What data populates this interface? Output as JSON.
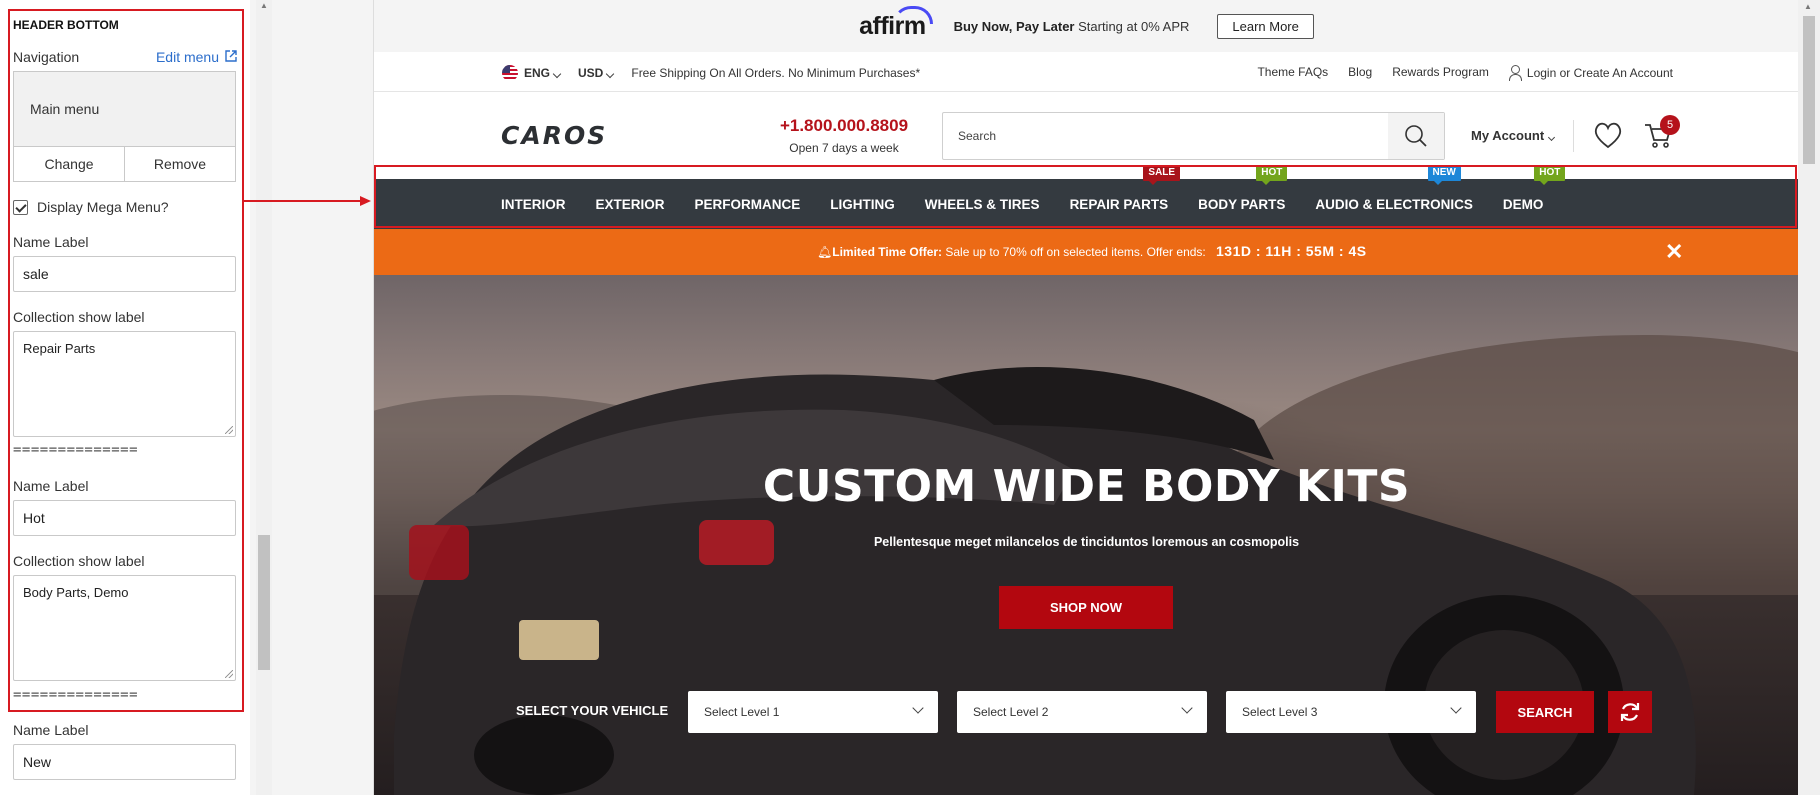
{
  "settings": {
    "section_title": "HEADER BOTTOM",
    "navigation_label": "Navigation",
    "edit_menu_label": "Edit menu",
    "menu_name": "Main menu",
    "change_label": "Change",
    "remove_label": "Remove",
    "mega_menu_label": "Display Mega Menu?",
    "mega_menu_checked": true,
    "separator": "==============",
    "groups": [
      {
        "name_label": "Name Label",
        "name_value": "sale",
        "collection_label": "Collection show label",
        "collection_value": "Repair Parts"
      },
      {
        "name_label": "Name Label",
        "name_value": "Hot",
        "collection_label": "Collection show label",
        "collection_value": "Body Parts, Demo"
      },
      {
        "name_label": "Name Label",
        "name_value": "New"
      }
    ]
  },
  "store": {
    "affirm": {
      "logo": "affirm",
      "headline_bold": "Buy Now, Pay Later",
      "headline_rest": " Starting at 0% APR",
      "button": "Learn More"
    },
    "topbar": {
      "language": "ENG",
      "currency": "USD",
      "shipping": "Free Shipping On All Orders. No Minimum Purchases*",
      "links": [
        "Theme FAQs",
        "Blog",
        "Rewards Program"
      ],
      "login": "Login or Create An Account"
    },
    "header": {
      "logo_text": "CAROS",
      "phone": "+1.800.000.8809",
      "hours": "Open 7 days a week",
      "search_placeholder": "Search",
      "account": "My Account",
      "cart_count": "5"
    },
    "nav": [
      {
        "label": "INTERIOR"
      },
      {
        "label": "EXTERIOR"
      },
      {
        "label": "PERFORMANCE"
      },
      {
        "label": "LIGHTING"
      },
      {
        "label": "WHEELS & TIRES"
      },
      {
        "label": "REPAIR PARTS",
        "tag": "Sale"
      },
      {
        "label": "BODY PARTS",
        "tag": "Hot"
      },
      {
        "label": "AUDIO & ELECTRONICS",
        "tag": "New"
      },
      {
        "label": "DEMO",
        "tag": "Hot"
      }
    ],
    "promo": {
      "lead": "Limited Time Offer:",
      "text": " Sale up to 70% off on selected items. Offer ends:",
      "countdown": "131D : 11H : 55M : 4S"
    },
    "hero": {
      "title": "CUSTOM WIDE BODY KITS",
      "subtitle": "Pellentesque meget milancelos de tinciduntos loremous an cosmopolis",
      "cta": "SHOP NOW",
      "vehicle_label": "SELECT YOUR VEHICLE",
      "levels": [
        "Select Level 1",
        "Select Level 2",
        "Select Level 3"
      ],
      "search": "SEARCH"
    }
  },
  "colors": {
    "accent_red": "#b3070f",
    "nav_bg": "#343a40",
    "promo_orange": "#ec6a15",
    "highlight_frame": "#d71a21",
    "tag_sale": "#a8141b",
    "tag_hot": "#73a51c",
    "tag_new": "#1d87d8"
  }
}
